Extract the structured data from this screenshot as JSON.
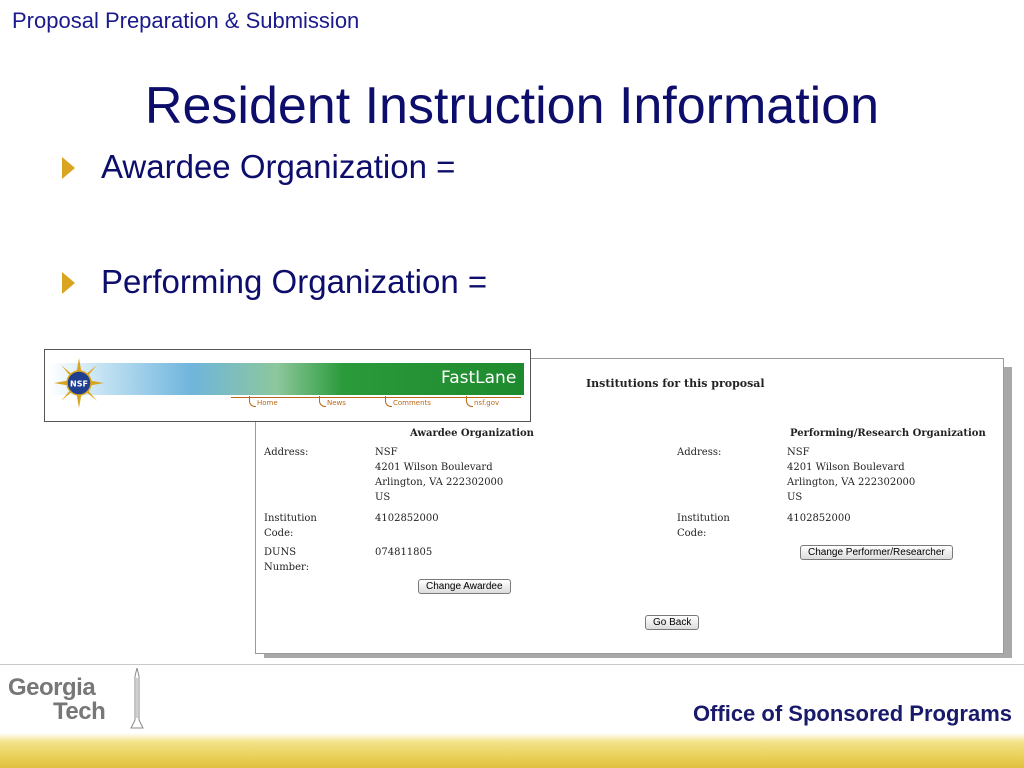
{
  "header": {
    "section": "Proposal Preparation & Submission"
  },
  "title": "Resident Instruction Information",
  "bullets": [
    {
      "text": "Awardee Organization ="
    },
    {
      "text": "Performing Organization ="
    }
  ],
  "banner": {
    "brand": "FastLane",
    "logo_text": "NSF",
    "nav": [
      "Home",
      "News",
      "Comments",
      "nsf.gov"
    ]
  },
  "screenshot": {
    "heading": "Institutions for this proposal",
    "awardee": {
      "title": "Awardee Organization",
      "address_label": "Address:",
      "address": [
        "NSF",
        "4201 Wilson Boulevard",
        "Arlington, VA 222302000",
        "US"
      ],
      "inst_code_label": "Institution Code:",
      "inst_code": "4102852000",
      "duns_label": "DUNS Number:",
      "duns": "074811805",
      "change_button": "Change Awardee"
    },
    "performing": {
      "title": "Performing/Research Organization",
      "address_label": "Address:",
      "address": [
        "NSF",
        "4201 Wilson Boulevard",
        "Arlington, VA 222302000",
        "US"
      ],
      "inst_code_label": "Institution Code:",
      "inst_code": "4102852000",
      "change_button": "Change Performer/Researcher"
    },
    "go_back_button": "Go Back"
  },
  "footer": {
    "logo_line1": "Georgia",
    "logo_line2": "Tech",
    "org": "Office of Sponsored Programs"
  },
  "colors": {
    "title_blue": "#0d0d6b",
    "bullet_arrow": "#d9a520",
    "footer_band": "#e9cf55"
  }
}
